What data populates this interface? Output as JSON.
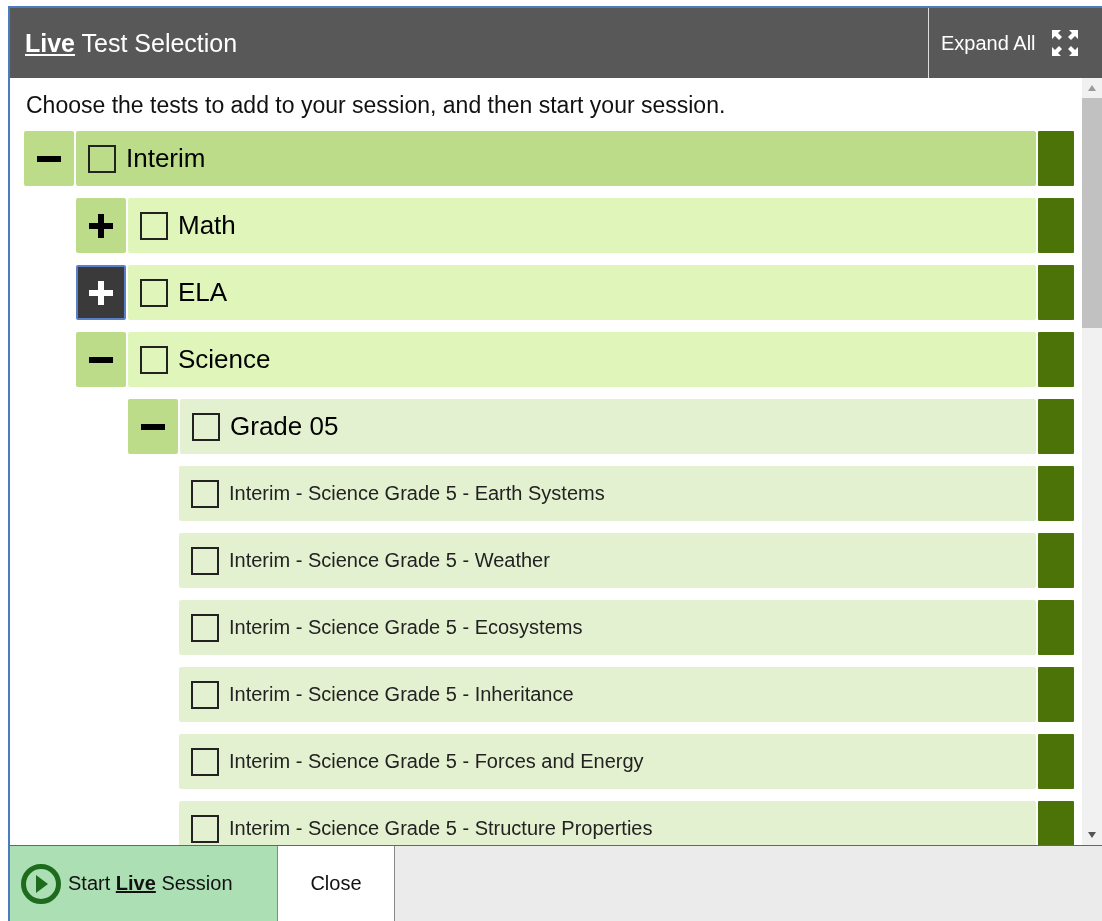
{
  "header": {
    "title": {
      "accent": "Live",
      "text": "Test Selection"
    },
    "expand_all": "Expand All"
  },
  "instructions": "Choose the tests to add to your session, and then start your session.",
  "tree": [
    {
      "kind": "group",
      "label": "Interim",
      "checked": false,
      "expanded": true,
      "focused": false,
      "children": [
        {
          "kind": "group",
          "label": "Math",
          "checked": false,
          "expanded": false,
          "focused": false
        },
        {
          "kind": "group",
          "label": "ELA",
          "checked": false,
          "expanded": false,
          "focused": true
        },
        {
          "kind": "group",
          "label": "Science",
          "checked": false,
          "expanded": true,
          "focused": false,
          "children": [
            {
              "kind": "group",
              "label": "Grade 05",
              "checked": false,
              "expanded": true,
              "focused": false,
              "children": [
                {
                  "kind": "test",
                  "label": "Interim - Science Grade 5 - Earth Systems",
                  "checked": false
                },
                {
                  "kind": "test",
                  "label": "Interim - Science Grade 5 - Weather",
                  "checked": false
                },
                {
                  "kind": "test",
                  "label": "Interim - Science Grade 5 - Ecosystems",
                  "checked": false
                },
                {
                  "kind": "test",
                  "label": "Interim - Science Grade 5 - Inheritance",
                  "checked": false
                },
                {
                  "kind": "test",
                  "label": "Interim - Science Grade 5 - Forces and Energy",
                  "checked": false
                },
                {
                  "kind": "test",
                  "label": "Interim - Science Grade 5 - Structure Properties",
                  "checked": false
                }
              ]
            }
          ]
        }
      ]
    }
  ],
  "footer": {
    "start": {
      "before": "Start",
      "accent": "Live",
      "after": "Session"
    },
    "close": "Close"
  }
}
